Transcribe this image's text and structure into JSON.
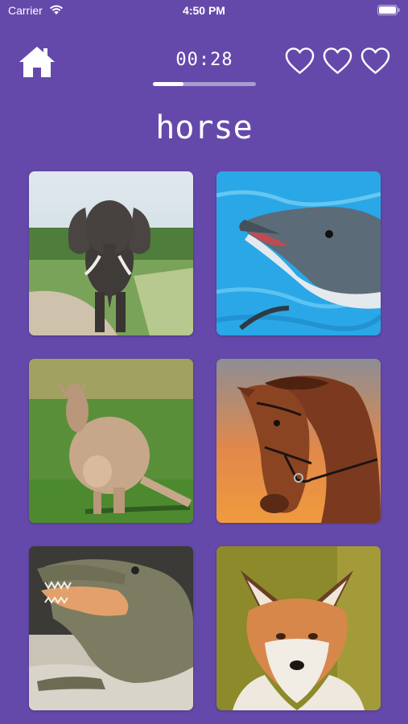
{
  "status_bar": {
    "carrier": "Carrier",
    "time": "4:50 PM"
  },
  "header": {
    "timer": "00:28",
    "timer_progress": 0.3,
    "lives": 3,
    "home_icon": "home-icon",
    "life_icon": "heart-outline-icon"
  },
  "prompt": {
    "word": "horse"
  },
  "animals": [
    {
      "name": "elephant"
    },
    {
      "name": "dolphin"
    },
    {
      "name": "kangaroo"
    },
    {
      "name": "horse"
    },
    {
      "name": "crocodile"
    },
    {
      "name": "fox"
    }
  ],
  "colors": {
    "background": "#6549AA",
    "foreground": "#FFFFFF"
  }
}
